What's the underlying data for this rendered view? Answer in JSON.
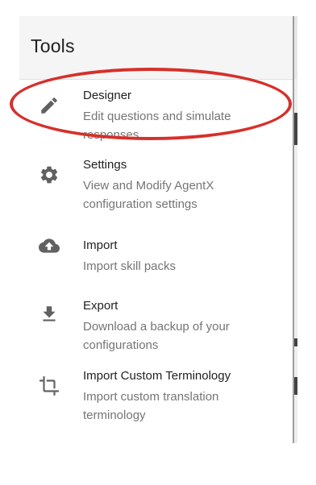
{
  "drawer": {
    "title": "Tools",
    "items": [
      {
        "icon": "pencil-icon",
        "label": "Designer",
        "description": "Edit questions and simulate responses"
      },
      {
        "icon": "gear-icon",
        "label": "Settings",
        "description": "View and Modify AgentX configuration settings"
      },
      {
        "icon": "cloud-upload-icon",
        "label": "Import",
        "description": "Import skill packs"
      },
      {
        "icon": "download-icon",
        "label": "Export",
        "description": "Download a backup of your configurations"
      },
      {
        "icon": "crop-icon",
        "label": "Import Custom Terminology",
        "description": "Import custom translation terminology"
      }
    ]
  },
  "colors": {
    "icon": "#616161",
    "highlight": "#d6302a",
    "header_bg": "#f5f5f5"
  }
}
